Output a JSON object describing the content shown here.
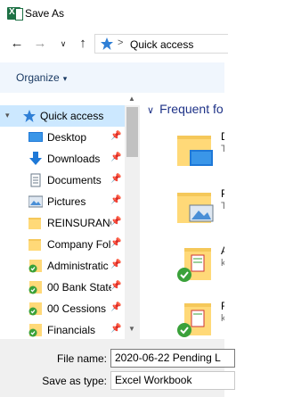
{
  "window": {
    "title": "Save As",
    "app_icon": "excel-icon"
  },
  "navigation": {
    "back": "arrow-left-icon",
    "forward": "arrow-right-icon",
    "recent": "chevron-down-icon",
    "up": "arrow-up-icon",
    "address": {
      "icon": "quick-access-star-icon",
      "separator": ">",
      "location": "Quick access"
    }
  },
  "commandbar": {
    "organize_label": "Organize",
    "organize_caret": "▾"
  },
  "tree": {
    "quick_access": {
      "label": "Quick access",
      "expander": "▾"
    },
    "items": [
      {
        "label": "Desktop",
        "icon": "desktop-icon"
      },
      {
        "label": "Downloads",
        "icon": "downloads-icon"
      },
      {
        "label": "Documents",
        "icon": "documents-icon"
      },
      {
        "label": "Pictures",
        "icon": "pictures-icon"
      },
      {
        "label": "REINSURANC",
        "icon": "folder-icon"
      },
      {
        "label": "Company Fol",
        "icon": "folder-icon"
      },
      {
        "label": "Administratic",
        "icon": "synced-folder-icon"
      },
      {
        "label": "00 Bank State",
        "icon": "synced-folder-icon"
      },
      {
        "label": "00 Cessions",
        "icon": "synced-folder-icon"
      },
      {
        "label": "Financials",
        "icon": "synced-folder-icon"
      }
    ]
  },
  "content": {
    "group_header": "Frequent fo",
    "group_chevron": "∨",
    "folders": [
      {
        "name": "D",
        "sub": "T",
        "icon": "desktop-folder-icon"
      },
      {
        "name": "P",
        "sub": "T",
        "icon": "pictures-folder-icon"
      },
      {
        "name": "A",
        "sub": "k",
        "icon": "synced-folder-icon"
      },
      {
        "name": "F",
        "sub": "k",
        "icon": "synced-folder-icon"
      }
    ]
  },
  "footer": {
    "file_name_label": "File name:",
    "file_name_value": "2020-06-22   Pending L",
    "save_type_label": "Save as type:",
    "save_type_value": "Excel Workbook"
  },
  "colors": {
    "accent": "#1e3287",
    "selection": "#cce8ff",
    "cmdbar": "#f0f6fd",
    "folder": "#f5c85a",
    "sync_green": "#3aa13a"
  }
}
